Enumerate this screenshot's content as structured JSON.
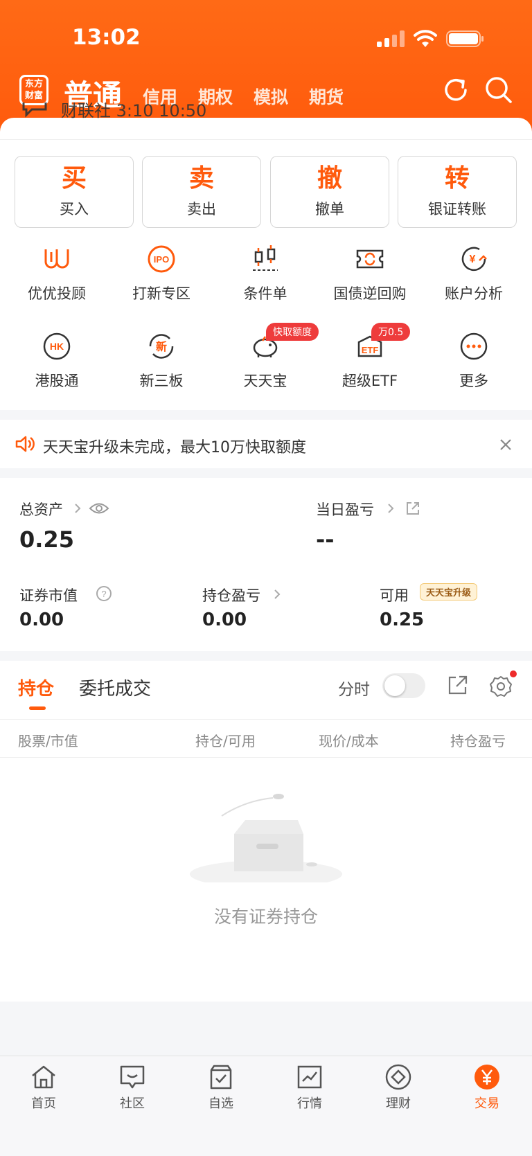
{
  "status_bar": {
    "time": "13:02"
  },
  "header": {
    "logo_text": "东方财富",
    "account_type": "普通",
    "tabs": [
      "信用",
      "期权",
      "模拟",
      "期货"
    ]
  },
  "peek_text": "财联社  3:10     10:50",
  "big_actions": [
    {
      "glyph": "买",
      "label": "买入"
    },
    {
      "glyph": "卖",
      "label": "卖出"
    },
    {
      "glyph": "撤",
      "label": "撤单"
    },
    {
      "glyph": "转",
      "label": "银证转账"
    }
  ],
  "grid": [
    {
      "label": "优优投顾",
      "icon": "uu-advisor-icon"
    },
    {
      "label": "打新专区",
      "icon": "ipo-icon"
    },
    {
      "label": "条件单",
      "icon": "condition-order-icon"
    },
    {
      "label": "国债逆回购",
      "icon": "reverse-repo-icon"
    },
    {
      "label": "账户分析",
      "icon": "account-analysis-icon"
    },
    {
      "label": "港股通",
      "icon": "hk-connect-icon"
    },
    {
      "label": "新三板",
      "icon": "neeq-icon"
    },
    {
      "label": "天天宝",
      "icon": "piggy-bank-icon",
      "tag": "快取额度"
    },
    {
      "label": "超级ETF",
      "icon": "etf-icon",
      "tag": "万0.5"
    },
    {
      "label": "更多",
      "icon": "more-icon"
    }
  ],
  "notice": {
    "text": "天天宝升级未完成，最大10万快取额度"
  },
  "assets": {
    "total_label": "总资产",
    "total_value": "0.25",
    "daily_pl_label": "当日盈亏",
    "daily_pl_value": "--",
    "market_value_label": "证券市值",
    "market_value": "0.00",
    "position_pl_label": "持仓盈亏",
    "position_pl_value": "0.00",
    "available_label": "可用",
    "available_value": "0.25",
    "upgrade_badge": "天天宝升级"
  },
  "holdings": {
    "tab_active": "持仓",
    "tab_other": "委托成交",
    "timeshare_label": "分时",
    "columns": [
      "股票/市值",
      "持仓/可用",
      "现价/成本",
      "持仓盈亏"
    ],
    "empty_text": "没有证券持仓"
  },
  "tabbar": [
    {
      "label": "首页"
    },
    {
      "label": "社区"
    },
    {
      "label": "自选"
    },
    {
      "label": "行情"
    },
    {
      "label": "理财"
    },
    {
      "label": "交易"
    }
  ],
  "colors": {
    "brand": "#ff5a0c",
    "tag_red": "#ee3b3b"
  }
}
